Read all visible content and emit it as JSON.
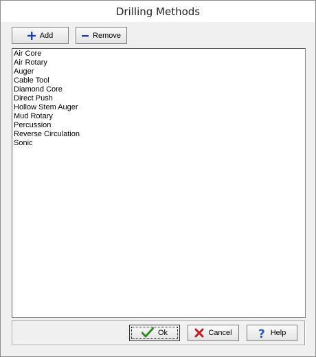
{
  "window": {
    "title": "Drilling Methods"
  },
  "toolbar": {
    "add": {
      "label": "Add",
      "icon": "plus-icon"
    },
    "remove": {
      "label": "Remove",
      "icon": "minus-icon"
    }
  },
  "methods": {
    "items": [
      "Air Core",
      "Air Rotary",
      "Auger",
      "Cable Tool",
      "Diamond Core",
      "Direct Push",
      "Hollow Stem Auger",
      "Mud Rotary",
      "Percussion",
      "Reverse Circulation",
      "Sonic"
    ]
  },
  "footer": {
    "ok": {
      "label": "Ok",
      "icon": "checkmark-icon",
      "color": "#2e8b1e"
    },
    "cancel": {
      "label": "Cancel",
      "icon": "x-icon",
      "color": "#c0181f"
    },
    "help": {
      "label": "Help",
      "icon": "question-icon",
      "color": "#1e5bc6"
    }
  },
  "colors": {
    "accent_blue": "#1d3fb0",
    "background": "#f0f0f0"
  }
}
